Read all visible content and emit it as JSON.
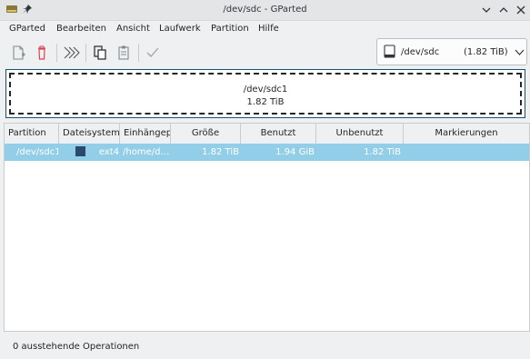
{
  "window": {
    "title": "/dev/sdc - GParted"
  },
  "menu": [
    "GParted",
    "Bearbeiten",
    "Ansicht",
    "Laufwerk",
    "Partition",
    "Hilfe"
  ],
  "device_selector": {
    "name": "/dev/sdc",
    "size": "(1.82 TiB)"
  },
  "visual": {
    "partition": "/dev/sdc1",
    "size": "1.82 TiB"
  },
  "table": {
    "headers": [
      "Partition",
      "Dateisystem",
      "Einhängepunkt",
      "Größe",
      "Benutzt",
      "Unbenutzt",
      "Markierungen"
    ],
    "rows": [
      {
        "partition": "/dev/sdc1",
        "filesystem": "ext4",
        "mountpoint": "/home/d…",
        "size": "1.82 TiB",
        "used": "1.94 GiB",
        "unused": "1.82 TiB",
        "flags": "",
        "fs_color": "#2b4a6b"
      }
    ]
  },
  "status": {
    "pending": "0 ausstehende Operationen"
  }
}
